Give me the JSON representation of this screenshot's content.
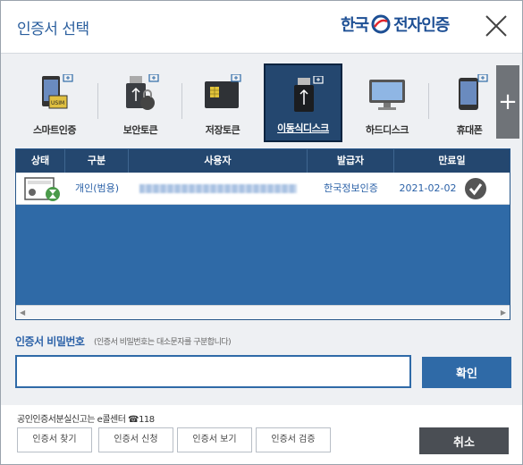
{
  "dialog": {
    "title": "인증서 선택",
    "brand_left": "한국",
    "brand_right": "전자인증"
  },
  "storage_types": [
    {
      "label": "스마트인증",
      "icon": "smartphone-usim-icon",
      "selected": false
    },
    {
      "label": "보안토큰",
      "icon": "usb-lock-icon",
      "selected": false
    },
    {
      "label": "저장토큰",
      "icon": "token-card-icon",
      "selected": false
    },
    {
      "label": "이동식디스크",
      "icon": "usb-drive-icon",
      "selected": true
    },
    {
      "label": "하드디스크",
      "icon": "monitor-icon",
      "selected": false
    },
    {
      "label": "휴대폰",
      "icon": "mobile-phone-icon",
      "selected": false
    }
  ],
  "more_storage_label": "+",
  "table": {
    "columns": [
      "상태",
      "구분",
      "사용자",
      "발급자",
      "만료일"
    ],
    "rows": [
      {
        "type": "개인(범용)",
        "issuer": "한국정보인증",
        "expiry": "2021-02-02"
      }
    ]
  },
  "password": {
    "label": "인증서 비밀번호",
    "hint": "(인증서 비밀번호는 대소문자를 구분합니다)",
    "value": "",
    "confirm_label": "확인"
  },
  "footer": {
    "notice": "공인인증서분실신고는 e콜센터 ☎118",
    "buttons": [
      "인증서 찾기",
      "인증서 신청",
      "인증서 보기",
      "인증서 검증"
    ],
    "cancel_label": "취소"
  },
  "colors": {
    "accent": "#2f6aa7",
    "header_dark": "#24476f",
    "cancel": "#4a4e54"
  }
}
